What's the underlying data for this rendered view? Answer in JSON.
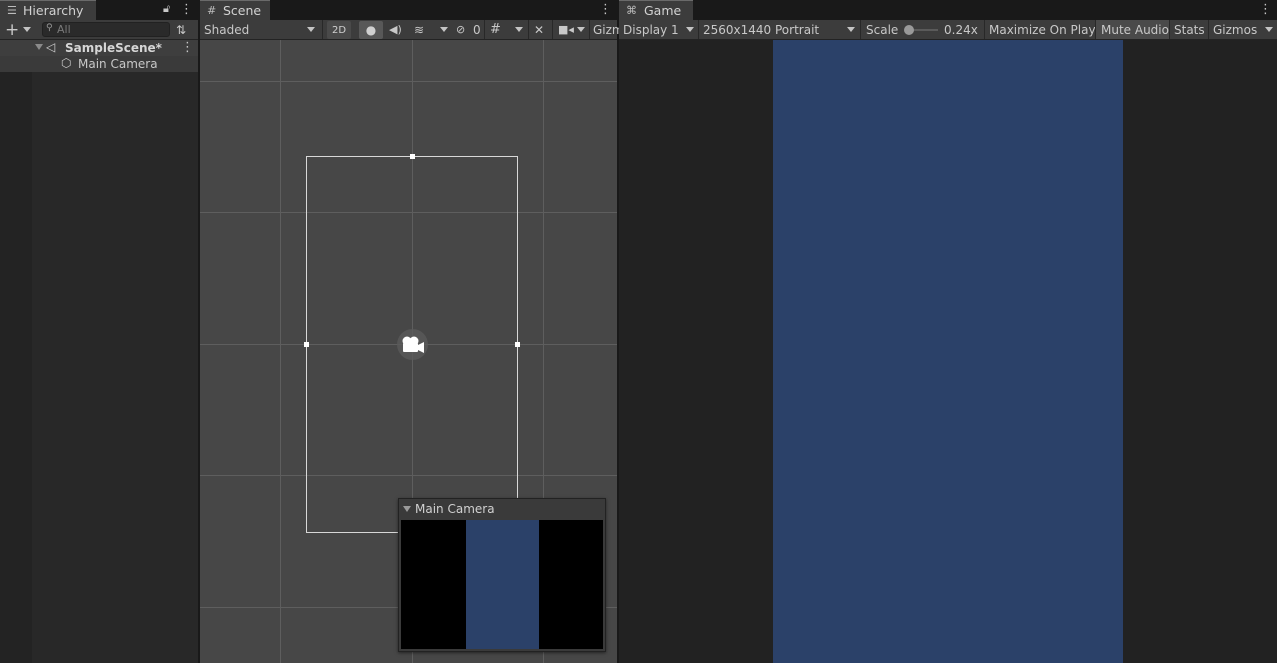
{
  "hierarchy": {
    "tab_label": "Hierarchy",
    "search_placeholder": "All",
    "scene_name": "SampleScene*",
    "items": [
      {
        "label": "Main Camera"
      }
    ]
  },
  "scene": {
    "tab_label": "Scene",
    "shading_mode": "Shaded",
    "mode_2d": "2D",
    "hidden_count": "0",
    "gizmos_label": "Gizm",
    "camera_preview": {
      "title": "Main Camera",
      "background_color": "#000000",
      "view_color": "#2b4169"
    }
  },
  "game": {
    "tab_label": "Game",
    "display": "Display 1",
    "resolution": "2560x1440 Portrait",
    "scale_label": "Scale",
    "scale_value": "0.24x",
    "maximize_label": "Maximize On Play",
    "mute_label": "Mute Audio",
    "stats_label": "Stats",
    "gizmos_label": "Gizmos",
    "view_color": "#2b4169"
  }
}
